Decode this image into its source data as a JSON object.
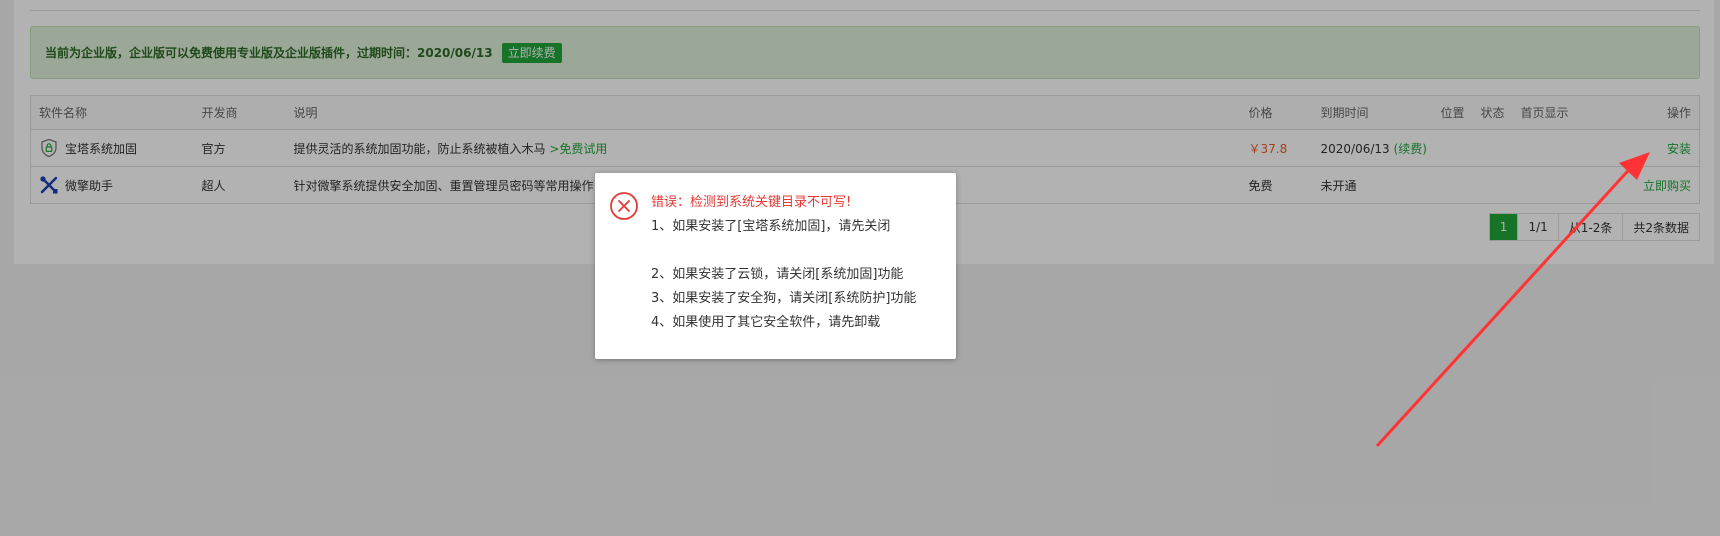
{
  "notice": {
    "text": "当前为企业版，企业版可以免费使用专业版及企业版插件，过期时间：2020/06/13",
    "renew_label": "立即续费"
  },
  "table": {
    "headers": {
      "name": "软件名称",
      "developer": "开发商",
      "description": "说明",
      "price": "价格",
      "expire": "到期时间",
      "position": "位置",
      "status": "状态",
      "home": "首页显示",
      "op": "操作"
    },
    "rows": [
      {
        "name": "宝塔系统加固",
        "icon": "shield-lock-icon",
        "developer": "官方",
        "description": "提供灵活的系统加固功能，防止系统被植入木马",
        "trial_link": ">免费试用",
        "price": "￥37.8",
        "expire": "2020/06/13",
        "renew_link": "续费",
        "op": "安装"
      },
      {
        "name": "微擎助手",
        "icon": "tools-icon",
        "developer": "超人",
        "description": "针对微擎系统提供安全加固、重置管理员密码等常用操作",
        "price": "免费",
        "expire": "未开通",
        "op": "立即购买"
      }
    ]
  },
  "pager": {
    "current": "1",
    "pages": "1/1",
    "range": "从1-2条",
    "total": "共2条数据"
  },
  "dialog": {
    "title": "错误：检测到系统关键目录不可写!",
    "lines": [
      "1、如果安装了[宝塔系统加固]，请先关闭",
      "2、如果安装了云锁，请关闭[系统加固]功能",
      "3、如果安装了安全狗，请关闭[系统防护]功能",
      "4、如果使用了其它安全软件，请先卸载"
    ]
  },
  "colors": {
    "accent_green": "#20a53a",
    "price_orange": "#f0592a",
    "error_red": "#e53935",
    "annotation_arrow": "#ff3333"
  }
}
